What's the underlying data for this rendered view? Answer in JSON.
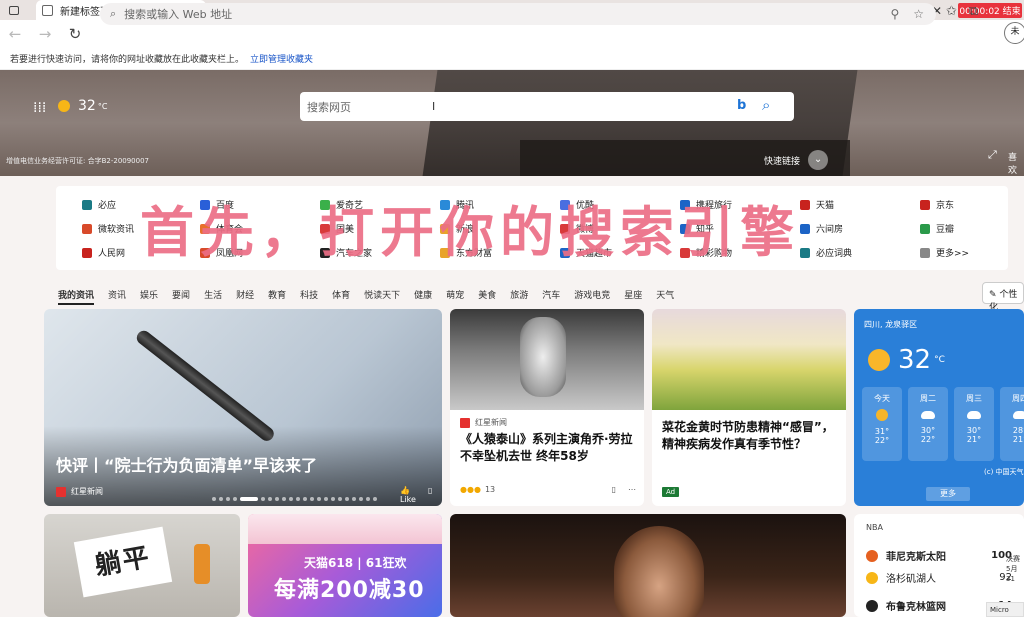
{
  "tab": {
    "title": "新建标签页",
    "close": "×",
    "new": "+"
  },
  "recorder": {
    "timer": "00:00:02 结束"
  },
  "address": {
    "placeholder": "搜索或输入 Web 地址"
  },
  "profile": {
    "label": "未"
  },
  "favorites": {
    "hint": "若要进行快速访问，请将你的网址收藏放在此收藏夹栏上。",
    "link": "立即管理收藏夹"
  },
  "hero": {
    "temp": "32",
    "unit": "°C",
    "search_placeholder": "搜索网页",
    "license": "增值电信业务经营许可证: 合字B2-20090007",
    "quicklinks_label": "快速链接",
    "more_label": "喜欢"
  },
  "links": [
    {
      "label": "必应",
      "color": "#1a7a85"
    },
    {
      "label": "百度",
      "color": "#2a5fd8"
    },
    {
      "label": "爱奇艺",
      "color": "#3ab04a"
    },
    {
      "label": "腾讯",
      "color": "#2a8ad8"
    },
    {
      "label": "优酷",
      "color": "#4a6ee0"
    },
    {
      "label": "携程旅行",
      "color": "#1c64c6"
    },
    {
      "label": "天猫",
      "color": "#c8231e"
    },
    {
      "label": "京东",
      "color": "#c8231e"
    },
    {
      "label": "微软资讯",
      "color": "#d84a2a"
    },
    {
      "label": "体育会",
      "color": "#e8702a"
    },
    {
      "label": "国美",
      "color": "#d83a3a"
    },
    {
      "label": "新浪",
      "color": "#e8a32a"
    },
    {
      "label": "微博",
      "color": "#d83a3a"
    },
    {
      "label": "知乎",
      "color": "#1c64c6"
    },
    {
      "label": "六间房",
      "color": "#1c64c6"
    },
    {
      "label": "豆瓣",
      "color": "#2a9a4a"
    },
    {
      "label": "人民网",
      "color": "#c8231e"
    },
    {
      "label": "凤凰网",
      "color": "#d84a2a"
    },
    {
      "label": "汽车之家",
      "color": "#222222"
    },
    {
      "label": "东方财富",
      "color": "#e8a32a"
    },
    {
      "label": "天猫超市",
      "color": "#1c64c6"
    },
    {
      "label": "精彩购物",
      "color": "#d83a3a"
    },
    {
      "label": "必应词典",
      "color": "#1a7a85"
    },
    {
      "label": "更多>>",
      "color": "#888888"
    }
  ],
  "overlay_caption": "首先，打开你的搜索引擎",
  "categories": [
    "我的资讯",
    "资讯",
    "娱乐",
    "要闻",
    "生活",
    "财经",
    "教育",
    "科技",
    "体育",
    "悦读天下",
    "健康",
    "萌宠",
    "美食",
    "旅游",
    "汽车",
    "游戏电竞",
    "星座",
    "天气"
  ],
  "personalize": "个性化",
  "cards": {
    "main": {
      "title": "快评丨“院士行为负面清单”早该来了",
      "source": "红星新闻",
      "like": "Like"
    },
    "tarzan": {
      "source": "红星新闻",
      "title": "《人猿泰山》系列主演角乔·劳拉不幸坠机去世 终年58岁",
      "reactions": "13"
    },
    "flower": {
      "title": "菜花金黄时节防患精神“感冒”，精神疾病发作真有季节性？",
      "ad": "Ad"
    },
    "lie": {
      "sign": "躺平"
    },
    "tmall": {
      "line1": "天猫618 | 61狂欢",
      "line2": "每满200减30"
    }
  },
  "weather": {
    "location": "四川, 龙泉驿区",
    "temp": "32",
    "unit": "°C",
    "credit": "(c) 中国天气",
    "more": "更多",
    "days": [
      {
        "name": "今天",
        "icon": "sun-icon",
        "hi": "31°",
        "lo": "22°"
      },
      {
        "name": "周二",
        "icon": "cloud-icon",
        "hi": "30°",
        "lo": "22°"
      },
      {
        "name": "周三",
        "icon": "cloud-icon",
        "hi": "30°",
        "lo": "21°"
      },
      {
        "name": "周四",
        "icon": "cloud-icon",
        "hi": "28°",
        "lo": "21°"
      }
    ]
  },
  "nba": {
    "label": "NBA",
    "teams": [
      {
        "name": "菲尼克斯太阳",
        "score": "100",
        "win": true,
        "color": "#e56020"
      },
      {
        "name": "洛杉矶湖人",
        "score": "92",
        "win": false,
        "color": "#f7b617"
      },
      {
        "name": "布鲁克林篮网",
        "score": "14",
        "win": true,
        "color": "#222222"
      }
    ],
    "side": "决赛 5月31"
  },
  "taskbar": {
    "label": "Micro"
  }
}
